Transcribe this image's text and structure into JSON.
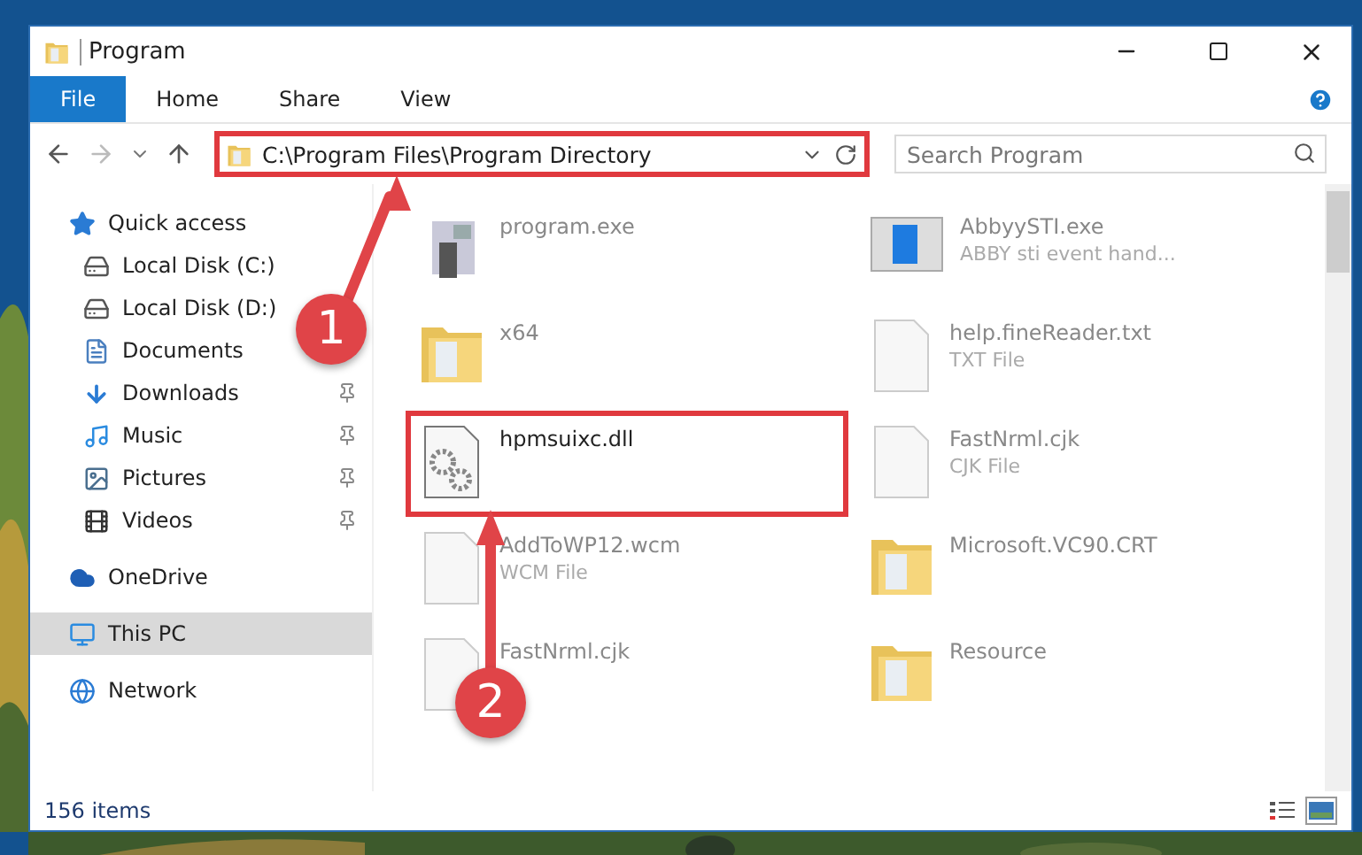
{
  "window": {
    "title": "Program"
  },
  "ribbon_tabs": [
    {
      "label": "File",
      "selected": true
    },
    {
      "label": "Home",
      "selected": false
    },
    {
      "label": "Share",
      "selected": false
    },
    {
      "label": "View",
      "selected": false
    }
  ],
  "address_bar": {
    "path": "C:\\Program Files\\Program Directory",
    "highlighted": true
  },
  "search": {
    "placeholder": "Search Program"
  },
  "sidebar": {
    "items": [
      {
        "label": "Quick access",
        "selected": false,
        "children": [
          {
            "label": "Local Disk (C:)",
            "pinned": false
          },
          {
            "label": "Local Disk (D:)",
            "pinned": false
          },
          {
            "label": "Documents",
            "pinned": false
          },
          {
            "label": "Downloads",
            "pinned": true
          },
          {
            "label": "Music",
            "pinned": true
          },
          {
            "label": "Pictures",
            "pinned": true
          },
          {
            "label": "Videos",
            "pinned": true
          }
        ]
      },
      {
        "label": "OneDrive",
        "selected": false
      },
      {
        "label": "This PC",
        "selected": true
      },
      {
        "label": "Network",
        "selected": false
      }
    ]
  },
  "files": [
    {
      "name": "program.exe",
      "kind": "exe",
      "highlighted": false
    },
    {
      "name": "AbbyySTI.exe",
      "subtitle": "ABBY sti event hand...",
      "kind": "app",
      "highlighted": false
    },
    {
      "name": "x64",
      "kind": "folder",
      "highlighted": false
    },
    {
      "name": "help.fineReader.txt",
      "subtitle": "TXT File",
      "kind": "text",
      "highlighted": false
    },
    {
      "name": "hpmsuixc.dll",
      "kind": "dll",
      "highlighted": true
    },
    {
      "name": "FastNrml.cjk",
      "subtitle": "CJK File",
      "kind": "text",
      "highlighted": false
    },
    {
      "name": "AddToWP12.wcm",
      "subtitle": "WCM File",
      "kind": "text",
      "highlighted": false
    },
    {
      "name": "Microsoft.VC90.CRT",
      "kind": "folder",
      "highlighted": false
    },
    {
      "name": "FastNrml.cjk",
      "kind": "text",
      "highlighted": false
    },
    {
      "name": "Resource",
      "kind": "folder",
      "highlighted": false
    }
  ],
  "status_bar": {
    "count": "156 items"
  },
  "view_buttons": [
    {
      "kind": "details",
      "selected": false
    },
    {
      "kind": "large",
      "selected": true
    }
  ],
  "callouts": [
    {
      "number": "1"
    },
    {
      "number": "2"
    }
  ]
}
